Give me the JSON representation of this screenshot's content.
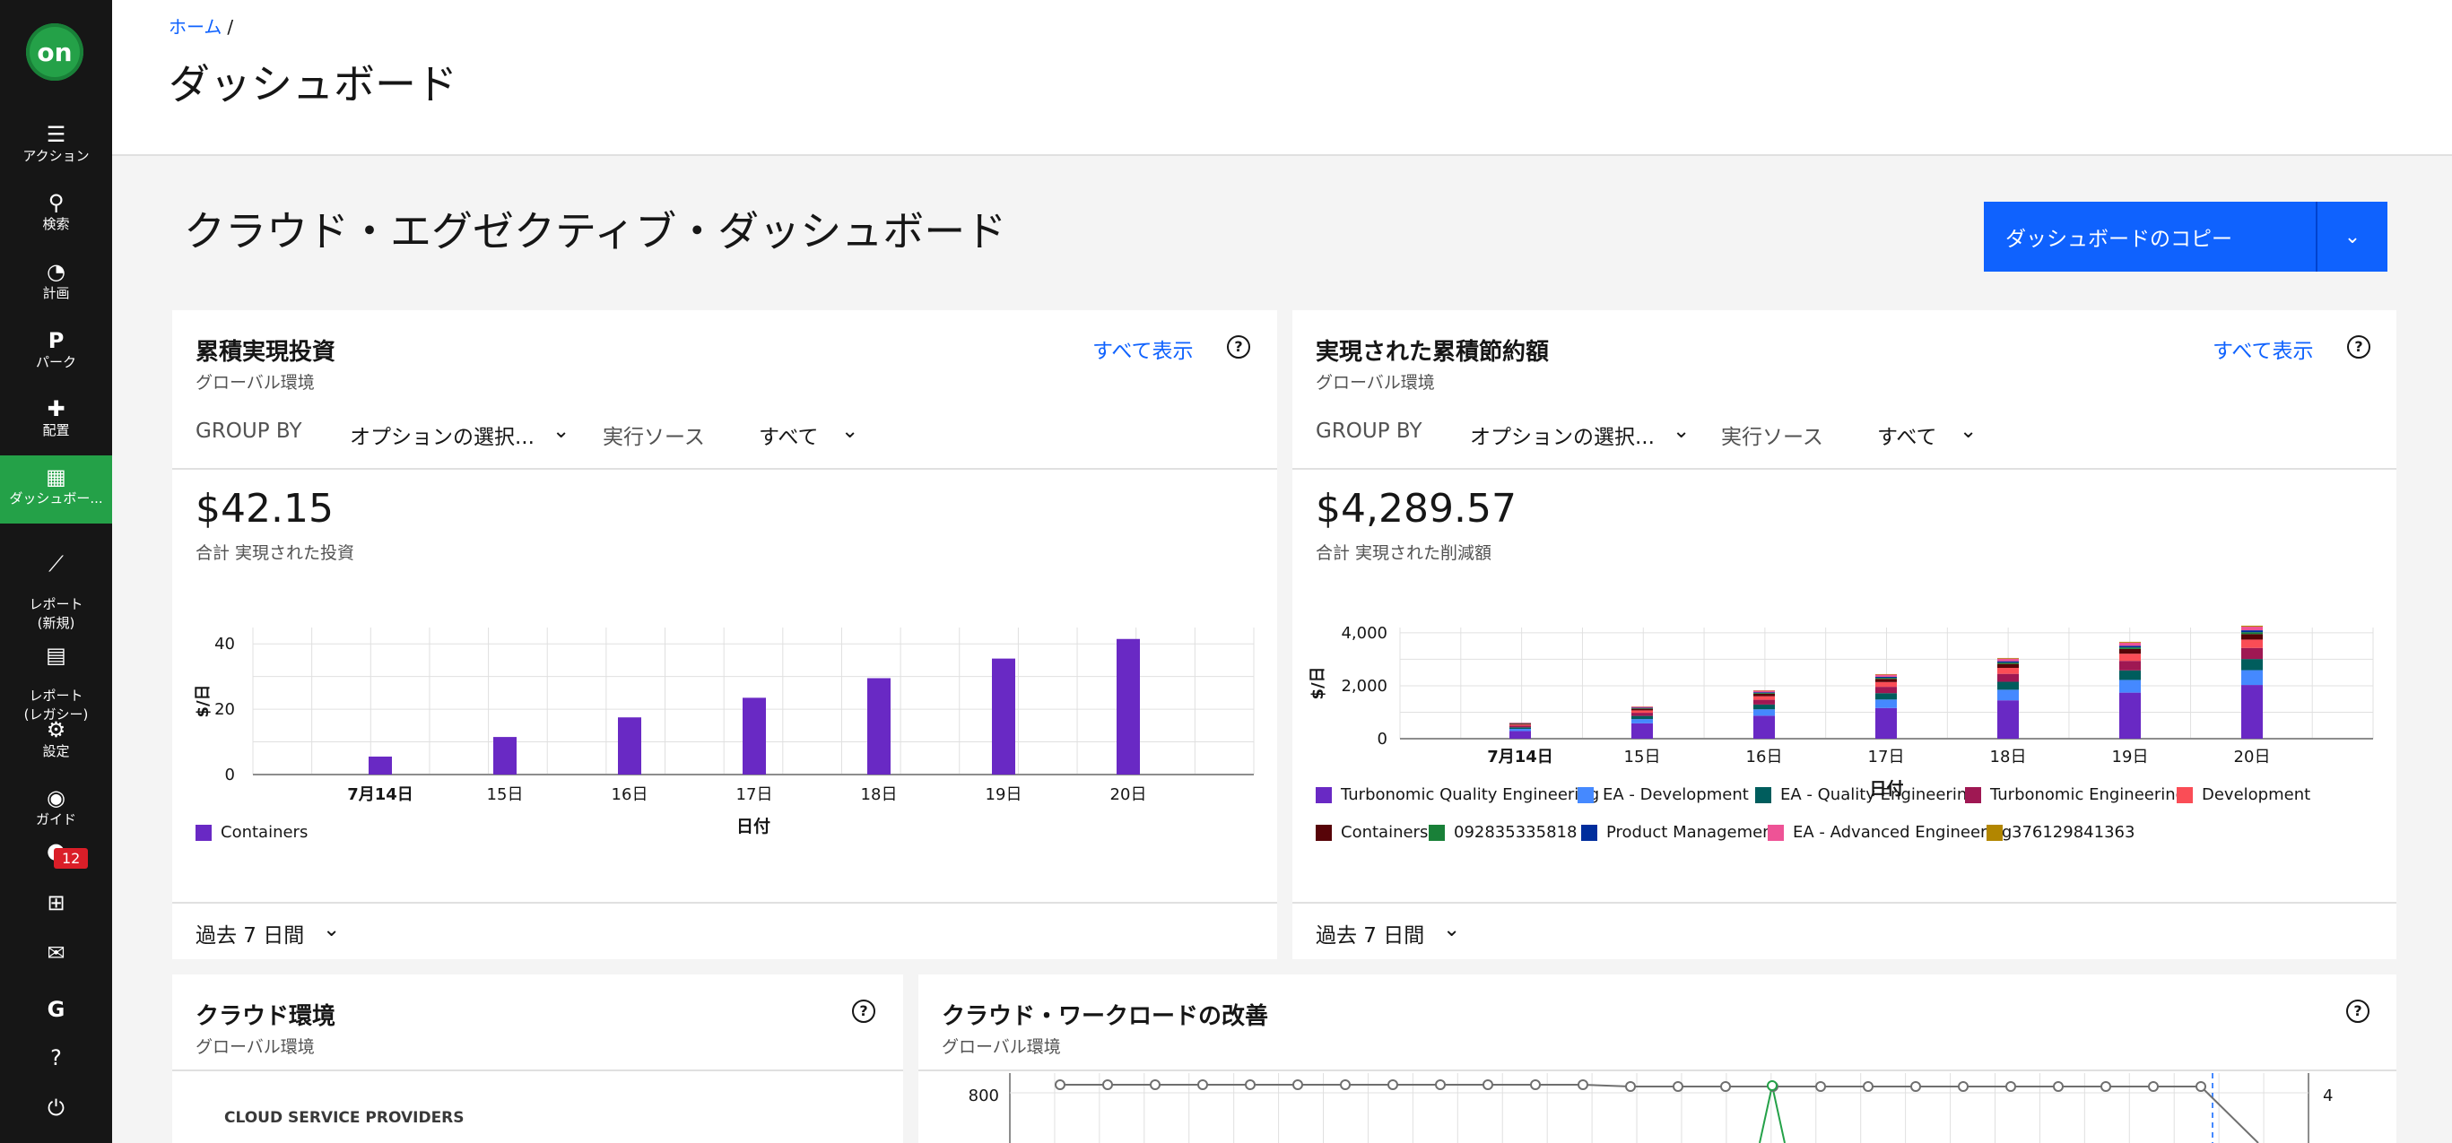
{
  "sidebar": {
    "logo_text": "on",
    "items": [
      {
        "label": "アクション",
        "icon": "action-list-icon"
      },
      {
        "label": "検索",
        "icon": "search-icon"
      },
      {
        "label": "計画",
        "icon": "lightbulb-icon"
      },
      {
        "label": "パーク",
        "icon": "parking-icon"
      },
      {
        "label": "配置",
        "icon": "puzzle-icon"
      },
      {
        "label": "ダッシュボー...",
        "icon": "dashboard-icon"
      },
      {
        "label": "レポート\n(新規)",
        "icon": "chart-line-icon"
      },
      {
        "label": "レポート\n(レガシー)",
        "icon": "clipboard-icon"
      },
      {
        "label": "設定",
        "icon": "gear-icon"
      },
      {
        "label": "ガイド",
        "icon": "compass-icon"
      }
    ],
    "notification_count": "12"
  },
  "header": {
    "breadcrumb_home": "ホーム",
    "breadcrumb_sep": "/",
    "title": "ダッシュボード"
  },
  "main": {
    "dashboard_title": "クラウド・エグゼクティブ・ダッシュボード",
    "copy_button": "ダッシュボードのコピー"
  },
  "card1": {
    "title": "累積実現投資",
    "subtitle": "グローバル環境",
    "view_all": "すべて表示",
    "group_by_label": "GROUP BY",
    "group_by_value": "オプションの選択...",
    "source_label": "実行ソース",
    "source_value": "すべて",
    "total": "$42.15",
    "total_caption": "合計 実現された投資",
    "period": "過去 7 日間",
    "legend": [
      {
        "name": "Containers",
        "color": "#6929c4"
      }
    ]
  },
  "card2": {
    "title": "実現された累積節約額",
    "subtitle": "グローバル環境",
    "view_all": "すべて表示",
    "group_by_label": "GROUP BY",
    "group_by_value": "オプションの選択...",
    "source_label": "実行ソース",
    "source_value": "すべて",
    "total": "$4,289.57",
    "total_caption": "合計 実現された削減額",
    "period": "過去 7 日間",
    "legend": [
      {
        "name": "Turbonomic Quality Engineering",
        "color": "#6929c4"
      },
      {
        "name": "EA - Development 1",
        "color": "#4589ff"
      },
      {
        "name": "EA - Quality Engineering",
        "color": "#005d5d"
      },
      {
        "name": "Turbonomic Engineering",
        "color": "#9f1853"
      },
      {
        "name": "Development",
        "color": "#fa4d56"
      },
      {
        "name": "Containers",
        "color": "#570408"
      },
      {
        "name": "092835335818",
        "color": "#198038"
      },
      {
        "name": "Product Management",
        "color": "#002d9c"
      },
      {
        "name": "EA - Advanced Engineering",
        "color": "#ee5396"
      },
      {
        "name": "376129841363",
        "color": "#b28600"
      }
    ]
  },
  "card3": {
    "title": "クラウド環境",
    "subtitle": "グローバル環境",
    "section_label": "CLOUD SERVICE PROVIDERS"
  },
  "card4": {
    "title": "クラウド・ワークロードの改善",
    "subtitle": "グローバル環境",
    "y_tick_left": "800",
    "y_tick_right": "4"
  },
  "chart_data": [
    {
      "type": "bar",
      "ylabel": "$/日",
      "xlabel": "日付",
      "categories": [
        "7月14日",
        "15日",
        "16日",
        "17日",
        "18日",
        "19日",
        "20日"
      ],
      "ylim": [
        0,
        45
      ],
      "yticks": [
        0,
        20,
        40
      ],
      "series": [
        {
          "name": "Containers",
          "values": [
            5.5,
            11.5,
            17.5,
            23.5,
            29.5,
            35.5,
            41.5
          ]
        }
      ],
      "grid": true
    },
    {
      "type": "bar",
      "stacked": true,
      "ylabel": "$/日",
      "xlabel": "日付",
      "categories": [
        "7月14日",
        "15日",
        "16日",
        "17日",
        "18日",
        "19日",
        "20日"
      ],
      "ylim": [
        0,
        4200
      ],
      "yticks": [
        "0",
        "2,000",
        "4,000"
      ],
      "series": [
        {
          "name": "Turbonomic Quality Engineering",
          "values": [
            290,
            580,
            870,
            1160,
            1450,
            1740,
            2030
          ]
        },
        {
          "name": "EA - Development 1",
          "values": [
            80,
            160,
            240,
            320,
            400,
            480,
            560
          ]
        },
        {
          "name": "EA - Quality Engineering",
          "values": [
            60,
            120,
            180,
            240,
            300,
            360,
            420
          ]
        },
        {
          "name": "Turbonomic Engineering",
          "values": [
            60,
            120,
            180,
            240,
            300,
            360,
            420
          ]
        },
        {
          "name": "Development",
          "values": [
            45,
            90,
            135,
            180,
            225,
            270,
            315
          ]
        },
        {
          "name": "Containers",
          "values": [
            30,
            60,
            90,
            120,
            150,
            180,
            210
          ]
        },
        {
          "name": "092835335818",
          "values": [
            10,
            20,
            30,
            40,
            50,
            60,
            70
          ]
        },
        {
          "name": "Product Management",
          "values": [
            10,
            20,
            30,
            40,
            50,
            60,
            70
          ]
        },
        {
          "name": "EA - Advanced Engineering",
          "values": [
            20,
            40,
            60,
            80,
            100,
            120,
            140
          ]
        },
        {
          "name": "376129841363",
          "values": [
            5,
            10,
            15,
            20,
            25,
            30,
            35
          ]
        }
      ],
      "grid": true
    }
  ]
}
